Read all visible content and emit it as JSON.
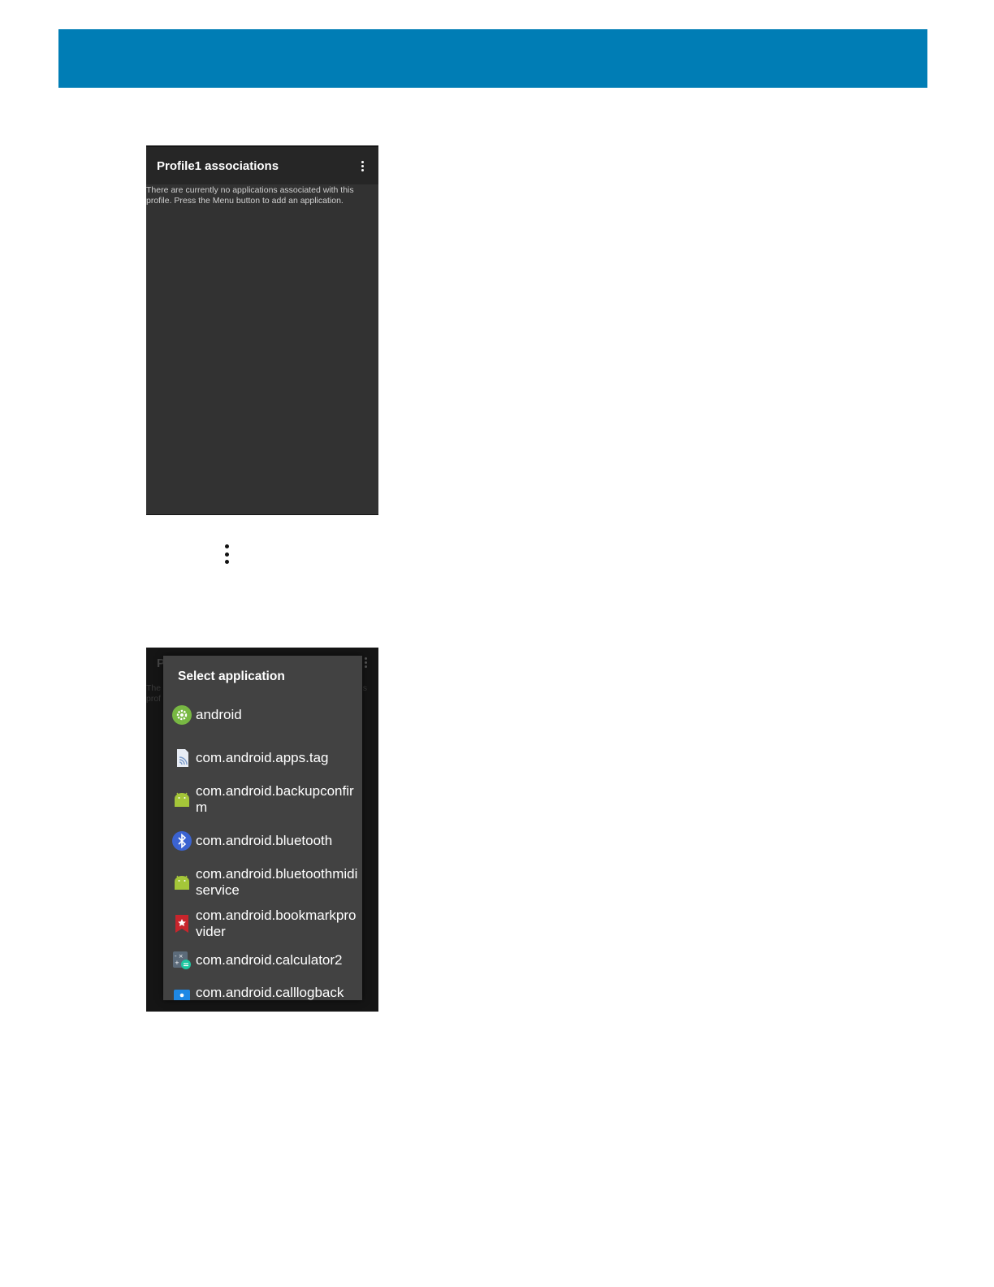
{
  "screen1": {
    "title": "Profile1 associations",
    "empty_line1": "There are currently no applications associated with this",
    "empty_line2": "profile. Press the Menu button to add an application."
  },
  "dialog": {
    "background_title": "P",
    "background_line1": "The",
    "background_line2": "prof",
    "background_right": "s",
    "title": "Select application",
    "apps": [
      {
        "label": "android",
        "icon": "android-system-icon"
      },
      {
        "label": "com.android.apps.tag",
        "icon": "nfc-tag-icon"
      },
      {
        "label": "com.android.backupconfirm",
        "icon": "android-robot-icon"
      },
      {
        "label": "com.android.bluetooth",
        "icon": "bluetooth-icon"
      },
      {
        "label": "com.android.bluetoothmidiservice",
        "icon": "android-robot-icon"
      },
      {
        "label": "com.android.bookmarkprovider",
        "icon": "bookmark-icon"
      },
      {
        "label": "com.android.calculator2",
        "icon": "calculator-icon"
      },
      {
        "label": "com.android.calllogback",
        "icon": "calllog-icon"
      }
    ]
  },
  "colors": {
    "header_band": "#007db5",
    "screen_bg": "#323232",
    "dialog_bg": "#424242"
  }
}
